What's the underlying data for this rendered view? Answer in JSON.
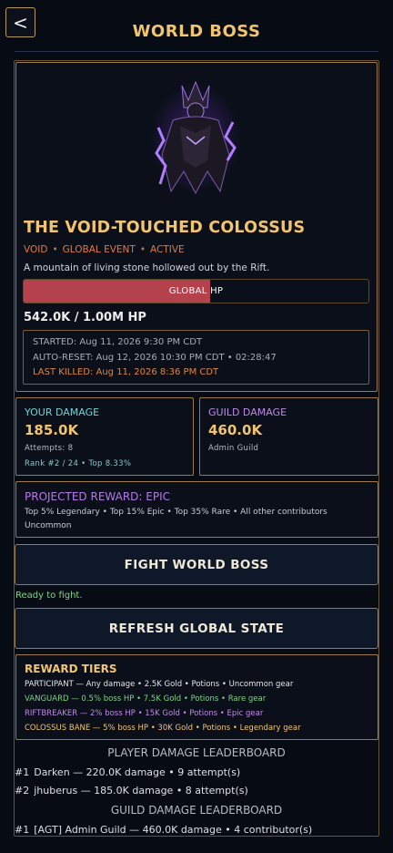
{
  "header": {
    "back_label": "<",
    "title": "WORLD BOSS"
  },
  "boss": {
    "name": "THE VOID-TOUCHED COLOSSUS",
    "tags": [
      "VOID",
      "GLOBAL EVENT",
      "ACTIVE"
    ],
    "description": "A mountain of living stone hollowed out by the Rift.",
    "hp_label": "GLOBAL HP",
    "hp_fraction": 0.542,
    "hp_text": "542.0K / 1.00M HP",
    "started": "STARTED: Aug 11, 2026  9:30 PM CDT",
    "auto_reset": "AUTO-RESET: Aug 12, 2026  10:30 PM CDT  •  02:28:47",
    "last_killed": "LAST KILLED: Aug 11, 2026  8:36 PM CDT"
  },
  "your_damage": {
    "title": "YOUR DAMAGE",
    "value": "185.0K",
    "attempts": "Attempts: 8",
    "rank": "Rank #2 / 24  •  Top 8.33%"
  },
  "guild_damage": {
    "title": "GUILD DAMAGE",
    "value": "460.0K",
    "guild": "Admin Guild"
  },
  "projected_reward": {
    "title": "PROJECTED REWARD: EPIC",
    "line1": "Top 5% Legendary  •  Top 15% Epic  •  Top 35% Rare  •  All other contributors",
    "line2": "Uncommon"
  },
  "actions": {
    "fight_label": "FIGHT WORLD BOSS",
    "status": "Ready to fight.",
    "refresh_label": "REFRESH GLOBAL STATE"
  },
  "reward_tiers": {
    "title": "REWARD TIERS",
    "tiers": [
      "PARTICIPANT — Any damage  •  2.5K Gold  •  Potions  •  Uncommon gear",
      "VANGUARD — 0.5% boss HP  •  7.5K Gold  •  Potions  •  Rare gear",
      "RIFTBREAKER — 2% boss HP  •  15K Gold  •  Potions  •  Epic gear",
      "COLOSSUS BANE — 5% boss HP  •  30K Gold  •  Potions  •  Legendary gear"
    ]
  },
  "leaderboards": {
    "player_heading": "PLAYER DAMAGE LEADERBOARD",
    "players": [
      {
        "rank": "#1",
        "text": "Darken  —  220.0K damage  •  9 attempt(s)"
      },
      {
        "rank": "#2",
        "text": "jhuberus  —  185.0K damage  •  8 attempt(s)"
      }
    ],
    "guild_heading": "GUILD DAMAGE LEADERBOARD",
    "guilds": [
      {
        "rank": "#1",
        "text": "[AGT] Admin Guild  —  460.0K damage  •  4 contributor(s)"
      }
    ]
  },
  "colors": {
    "accent_gold": "#f2c46d",
    "hp_fill": "#b5414d",
    "void_purple": "#b57ae8",
    "your_teal": "#6fd3d6",
    "ready_green": "#7ad68a"
  }
}
